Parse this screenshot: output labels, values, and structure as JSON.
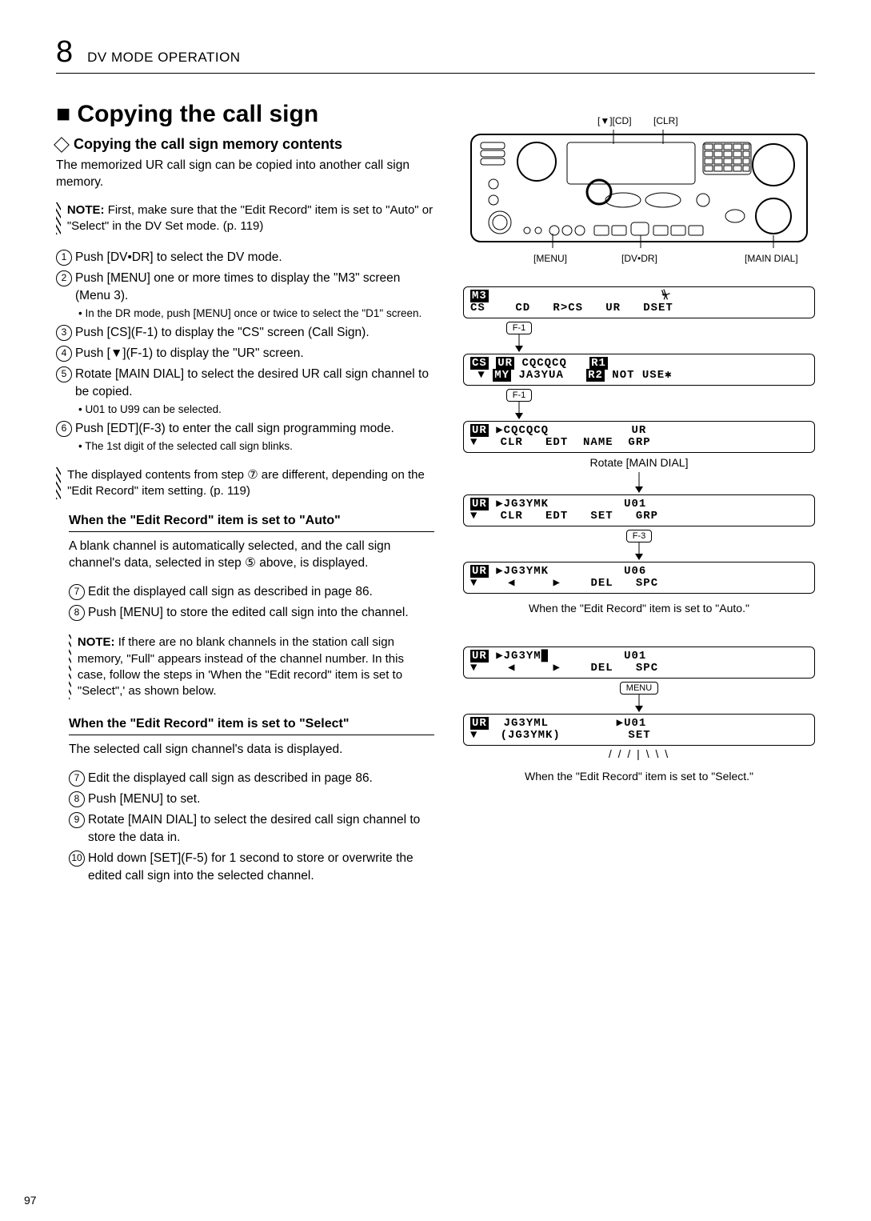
{
  "header": {
    "chapter_num": "8",
    "chapter_name": "DV MODE OPERATION"
  },
  "title": "■ Copying the call sign",
  "subtitle": "Copying the call sign memory contents",
  "intro": "The memorized UR call sign can be copied into another call sign memory.",
  "note_top": {
    "label": "NOTE:",
    "body": "First, make sure that the \"Edit Record\" item is set to \"Auto\" or \"Select\" in the DV Set mode. (p. 119)"
  },
  "steps_main": [
    {
      "n": "1",
      "text": "Push [DV•DR] to select the DV mode."
    },
    {
      "n": "2",
      "text": "Push [MENU] one or more times to display the \"M3\" screen (Menu 3).",
      "sub": "• In the DR mode, push [MENU] once or twice to select the \"D1\" screen."
    },
    {
      "n": "3",
      "text": "Push [CS](F-1) to display the \"CS\" screen (Call Sign)."
    },
    {
      "n": "4",
      "text": "Push [▼](F-1) to display the \"UR\" screen."
    },
    {
      "n": "5",
      "text": "Rotate [MAIN DIAL] to select the desired UR call sign channel to be copied.",
      "sub": "• U01 to U99 can be selected."
    },
    {
      "n": "6",
      "text": "Push [EDT](F-3) to enter the call sign programming mode.",
      "sub": "• The 1st digit of the selected call sign blinks."
    }
  ],
  "note_mid": "The displayed contents from step ⑦ are different, depending on the \"Edit Record\" item setting. (p. 119)",
  "auto_box": {
    "title": "When the \"Edit Record\" item is set to \"Auto\"",
    "body": "A blank channel is automatically selected, and the call sign channel's data, selected in step ⑤ above, is displayed.",
    "steps": [
      {
        "n": "7",
        "text": "Edit the displayed call sign as described in page 86."
      },
      {
        "n": "8",
        "text": "Push [MENU] to store the edited call sign into the channel."
      }
    ],
    "note": {
      "label": "NOTE:",
      "body": "If there are no blank channels in the station call sign memory, \"Full\" appears instead of the channel number. In this case, follow the steps in 'When the \"Edit record\" item is set to \"Select\",' as shown below."
    }
  },
  "select_box": {
    "title": "When the \"Edit Record\" item is set to \"Select\"",
    "body": "The selected call sign channel's data is displayed.",
    "steps": [
      {
        "n": "7",
        "text": "Edit the displayed call sign as described in page 86."
      },
      {
        "n": "8",
        "text": "Push [MENU] to set."
      },
      {
        "n": "9",
        "text": "Rotate [MAIN DIAL] to select the desired call sign channel to store the data in."
      },
      {
        "n": "10",
        "text": "Hold down [SET](F-5) for 1 second to store or overwrite the edited call sign into the selected channel."
      }
    ]
  },
  "radio_labels": {
    "cd": "[▼][CD]",
    "clr": "[CLR]",
    "menu": "[MENU]",
    "dvdr": "[DV•DR]",
    "main": "[MAIN DIAL]"
  },
  "f_keys": {
    "f1": "F-1",
    "f3": "F-3",
    "menu": "MENU"
  },
  "screens_auto": {
    "s1": {
      "tag": "M3",
      "l1": "CS    CD   R>CS   UR   DSET",
      "icon": "ant"
    },
    "s2": {
      "l1a": "CS",
      "l1b": "UR",
      "l1c": "CQCQCQ",
      "l1d": "R1",
      "l2a": "▼",
      "l2b": "MY",
      "l2c": "JA3YUA",
      "l2d": "R2",
      "l2e": "NOT USE✱"
    },
    "s3": {
      "tag": "UR",
      "l1": "▶CQCQCQ           UR",
      "l2": "▼   CLR   EDT  NAME  GRP"
    },
    "anno": "Rotate [MAIN DIAL]",
    "s4": {
      "tag": "UR",
      "l1": "▶JG3YMK          U01",
      "l2": "▼   CLR   EDT   SET   GRP"
    },
    "s5": {
      "tag": "UR",
      "l1": "▶JG3YMK          U06",
      "l2": "▼    ◀     ▶    DEL   SPC"
    },
    "caption": "When the \"Edit Record\" item is set to \"Auto.\""
  },
  "screens_select": {
    "s1": {
      "tag": "UR",
      "l1": "▶JG3YM█          U01",
      "l2": "▼    ◀     ▶    DEL   SPC"
    },
    "s2": {
      "tag": "UR",
      "l1": " JG3YML         ▶U01",
      "l2": "▼   (JG3YMK)         SET"
    },
    "caption": "When the \"Edit Record\" item is set to \"Select.\""
  },
  "page_number": "97"
}
